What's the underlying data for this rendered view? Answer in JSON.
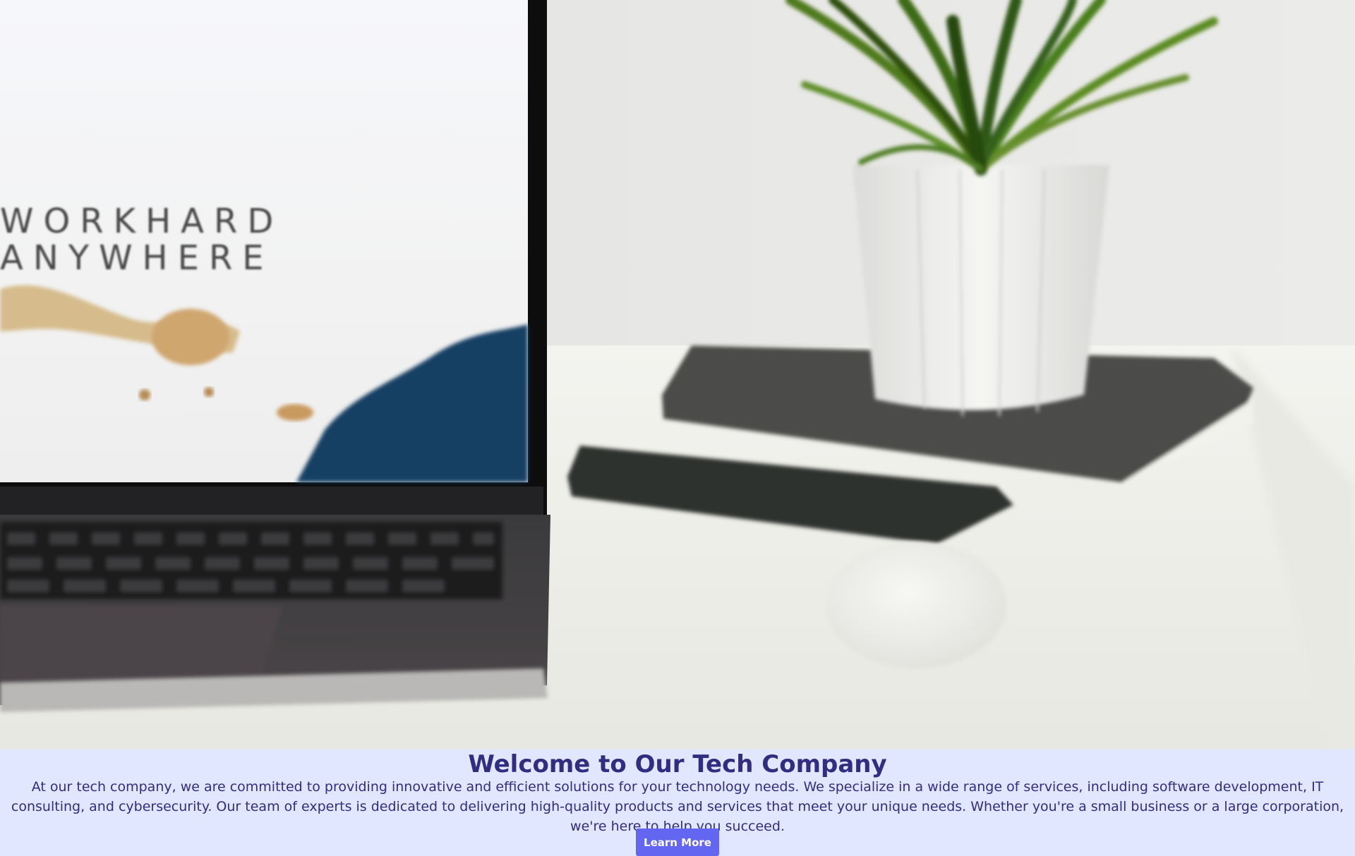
{
  "hero": {
    "image_alt": "Laptop, phone, mouse and a potted plant on a white desk",
    "screen_line1": "WORKHARD",
    "screen_line2": "ANYWHERE"
  },
  "intro": {
    "title": "Welcome to Our Tech Company",
    "body": "At our tech company, we are committed to providing innovative and efficient solutions for your technology needs. We specialize in a wide range of services, including software development, IT consulting, and cybersecurity. Our team of experts is dedicated to delivering high-quality products and services that meet your unique needs. Whether you're a small business or a large corporation, we're here to help you succeed.",
    "button_label": "Learn More"
  },
  "colors": {
    "section_background": "#e0e7ff",
    "heading_text": "#312e81",
    "button_background": "#6366f1",
    "button_text": "#ffffff"
  }
}
